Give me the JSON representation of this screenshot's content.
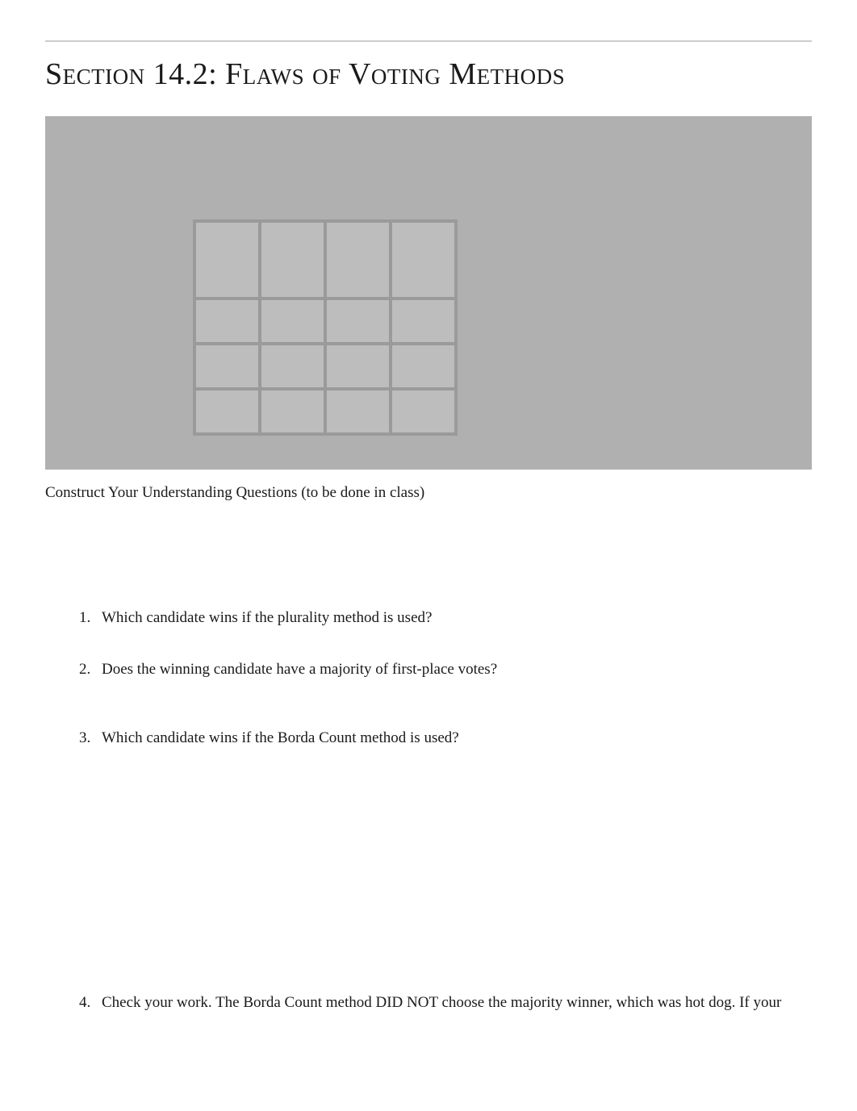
{
  "heading": "Section 14.2: Flaws of Voting Methods",
  "subtitle": "Construct Your Understanding Questions (to be done in class)",
  "questions": [
    {
      "num": "1.",
      "text": "Which candidate wins if the plurality method is used?"
    },
    {
      "num": "2.",
      "text": "Does the winning candidate have a majority of first-place votes?"
    },
    {
      "num": "3.",
      "text": "Which candidate wins if the Borda Count method is used?"
    },
    {
      "num": "4.",
      "text": "Check your work. The Borda Count method DID NOT choose the majority winner, which was hot dog. If your"
    }
  ]
}
